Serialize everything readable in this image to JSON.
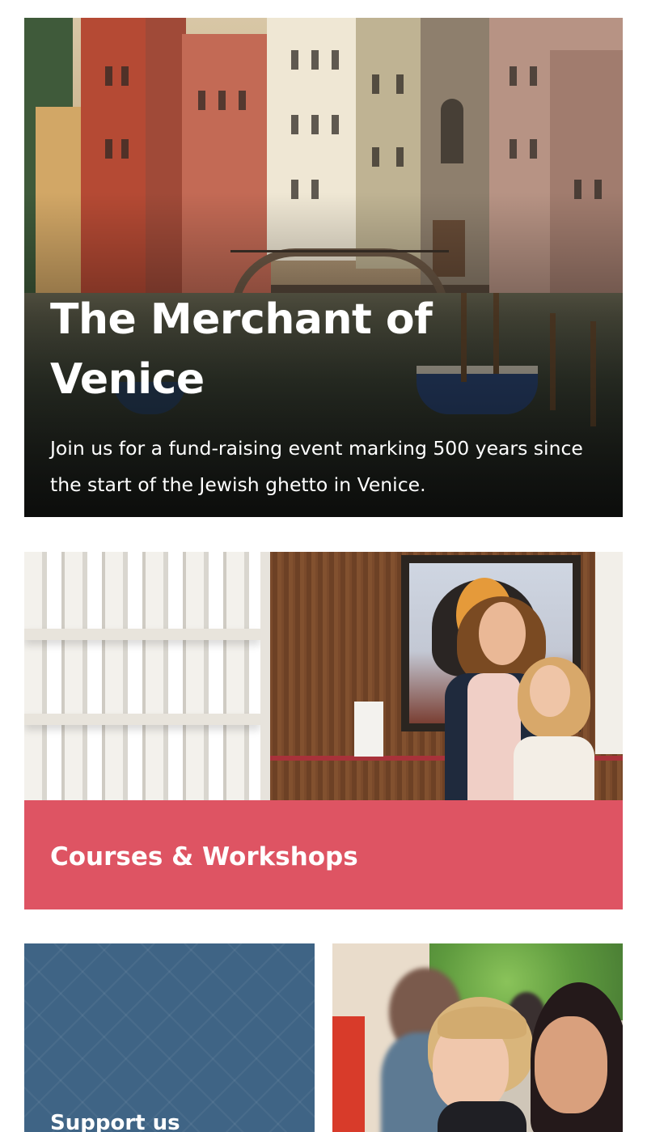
{
  "hero": {
    "title": "The Merchant of Venice",
    "description": "Join us for a fund-raising event marking 500 years since the start of the Jewish ghetto in Venice."
  },
  "courses": {
    "label": "Courses & Workshops",
    "band_color": "#de5463"
  },
  "support": {
    "label": "Support us",
    "bg_color": "#3f6485"
  }
}
